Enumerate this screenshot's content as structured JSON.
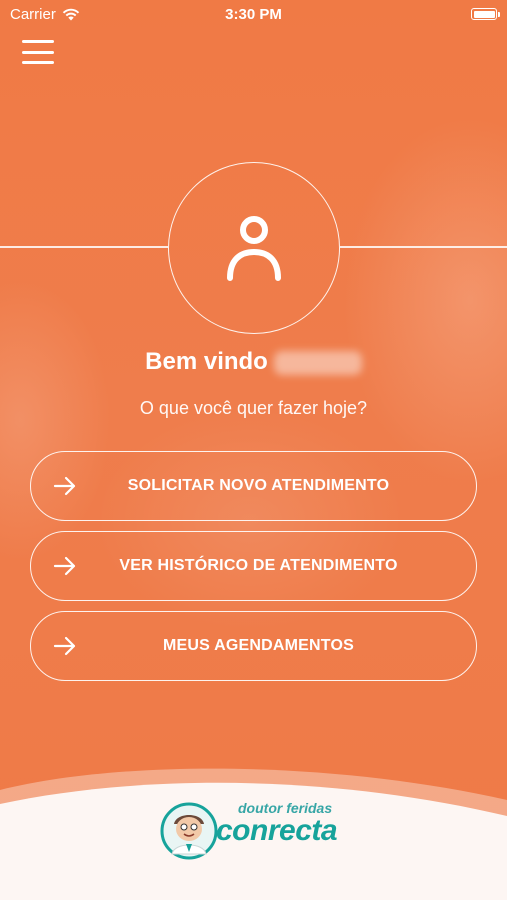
{
  "status_bar": {
    "carrier": "Carrier",
    "time": "3:30 PM",
    "battery_level": 1.0
  },
  "header": {
    "menu_icon": "hamburger-menu-icon"
  },
  "profile": {
    "avatar_icon": "user-outline-icon",
    "welcome_text": "Bem vindo",
    "question": "O que você quer fazer hoje?"
  },
  "actions": [
    {
      "label": "SOLICITAR NOVO ATENDIMENTO",
      "icon": "arrow-right-icon"
    },
    {
      "label": "VER HISTÓRICO DE ATENDIMENTO",
      "icon": "arrow-right-icon"
    },
    {
      "label": "MEUS AGENDAMENTOS",
      "icon": "arrow-right-icon"
    }
  ],
  "footer": {
    "logo_small_text": "doutor feridas",
    "logo_big_text": "conrecta"
  },
  "colors": {
    "primary": "#ef7a47",
    "white": "#ffffff",
    "logo_teal": "#17a39b"
  }
}
